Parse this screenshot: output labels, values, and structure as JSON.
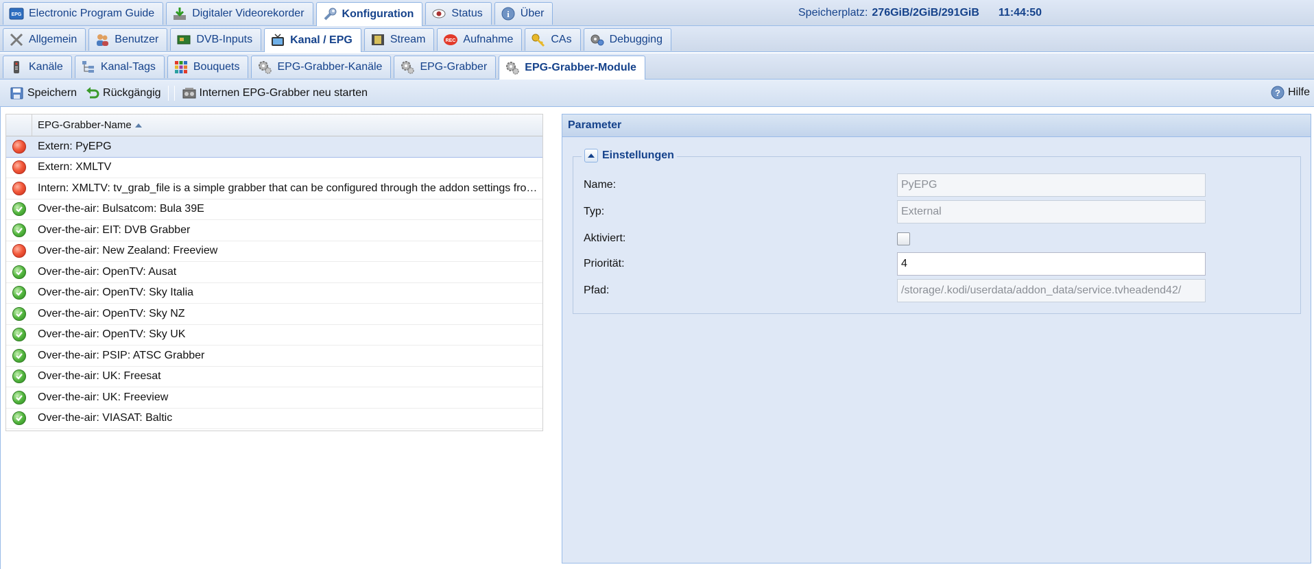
{
  "top_tabs": [
    {
      "label": "Electronic Program Guide",
      "icon": "epg-icon",
      "active": false
    },
    {
      "label": "Digitaler Videorekorder",
      "icon": "download-icon",
      "active": false
    },
    {
      "label": "Konfiguration",
      "icon": "wrench-icon",
      "active": true
    },
    {
      "label": "Status",
      "icon": "eye-icon",
      "active": false
    },
    {
      "label": "Über",
      "icon": "info-icon",
      "active": false
    }
  ],
  "status": {
    "storage_label": "Speicherplatz:",
    "storage_value": "276GiB/2GiB/291GiB",
    "clock": "11:44:50"
  },
  "config_tabs": [
    {
      "label": "Allgemein",
      "icon": "tools-icon",
      "active": false
    },
    {
      "label": "Benutzer",
      "icon": "users-icon",
      "active": false
    },
    {
      "label": "DVB-Inputs",
      "icon": "card-icon",
      "active": false
    },
    {
      "label": "Kanal / EPG",
      "icon": "tv-icon",
      "active": true
    },
    {
      "label": "Stream",
      "icon": "film-icon",
      "active": false
    },
    {
      "label": "Aufnahme",
      "icon": "rec-icon",
      "active": false
    },
    {
      "label": "CAs",
      "icon": "key-icon",
      "active": false
    },
    {
      "label": "Debugging",
      "icon": "gears-icon",
      "active": false
    }
  ],
  "channel_tabs": [
    {
      "label": "Kanäle",
      "icon": "remote-icon",
      "active": false
    },
    {
      "label": "Kanal-Tags",
      "icon": "tree-icon",
      "active": false
    },
    {
      "label": "Bouquets",
      "icon": "grid-color-icon",
      "active": false
    },
    {
      "label": "EPG-Grabber-Kanäle",
      "icon": "cog-icon",
      "active": false
    },
    {
      "label": "EPG-Grabber",
      "icon": "cog-icon",
      "active": false
    },
    {
      "label": "EPG-Grabber-Module",
      "icon": "cog-icon",
      "active": true
    }
  ],
  "toolbar": {
    "save_label": "Speichern",
    "undo_label": "Rückgängig",
    "restart_label": "Internen EPG-Grabber neu starten",
    "help_label": "Hilfe"
  },
  "grid": {
    "column_header": "EPG-Grabber-Name",
    "rows": [
      {
        "name": "Extern: PyEPG",
        "enabled": false,
        "selected": true
      },
      {
        "name": "Extern: XMLTV",
        "enabled": false,
        "selected": false
      },
      {
        "name": "Intern: XMLTV: tv_grab_file is a simple grabber that can be configured through the addon settings from Kodi",
        "enabled": false,
        "selected": false
      },
      {
        "name": "Over-the-air: Bulsatcom: Bula 39E",
        "enabled": true,
        "selected": false
      },
      {
        "name": "Over-the-air: EIT: DVB Grabber",
        "enabled": true,
        "selected": false
      },
      {
        "name": "Over-the-air: New Zealand: Freeview",
        "enabled": false,
        "selected": false
      },
      {
        "name": "Over-the-air: OpenTV: Ausat",
        "enabled": true,
        "selected": false
      },
      {
        "name": "Over-the-air: OpenTV: Sky Italia",
        "enabled": true,
        "selected": false
      },
      {
        "name": "Over-the-air: OpenTV: Sky NZ",
        "enabled": true,
        "selected": false
      },
      {
        "name": "Over-the-air: OpenTV: Sky UK",
        "enabled": true,
        "selected": false
      },
      {
        "name": "Over-the-air: PSIP: ATSC Grabber",
        "enabled": true,
        "selected": false
      },
      {
        "name": "Over-the-air: UK: Freesat",
        "enabled": true,
        "selected": false
      },
      {
        "name": "Over-the-air: UK: Freeview",
        "enabled": true,
        "selected": false
      },
      {
        "name": "Over-the-air: VIASAT: Baltic",
        "enabled": true,
        "selected": false
      }
    ]
  },
  "panel": {
    "title": "Parameter",
    "fieldset_title": "Einstellungen",
    "fields": {
      "name_label": "Name:",
      "name_value": "PyEPG",
      "type_label": "Typ:",
      "type_value": "External",
      "enabled_label": "Aktiviert:",
      "enabled_value": false,
      "priority_label": "Priorität:",
      "priority_value": "4",
      "path_label": "Pfad:",
      "path_value": "/storage/.kodi/userdata/addon_data/service.tvheadend42/"
    }
  }
}
